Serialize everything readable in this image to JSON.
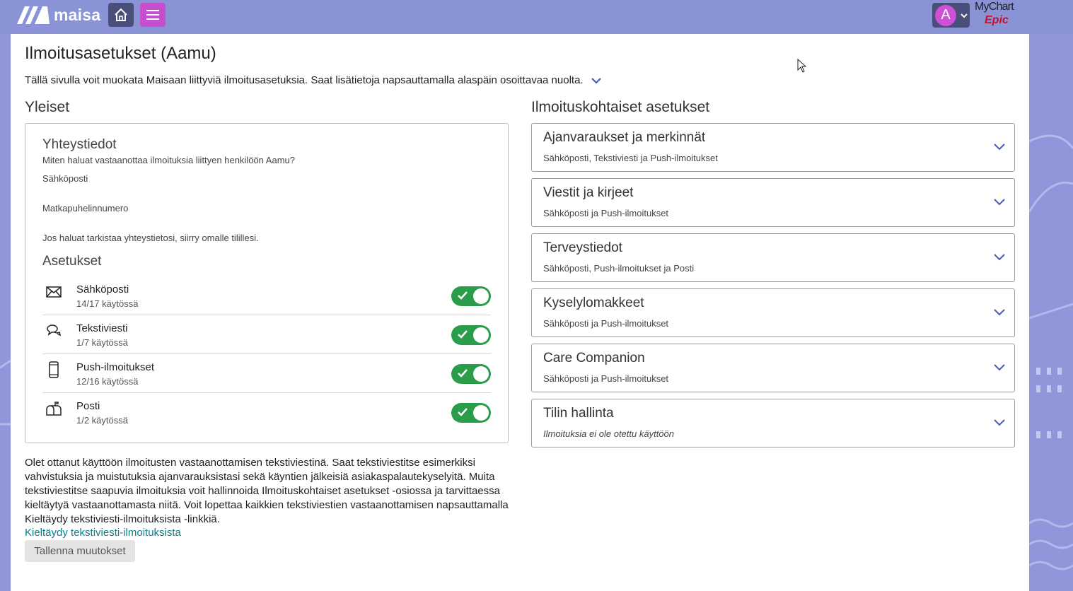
{
  "header": {
    "brand": "maisa",
    "account_initial": "A",
    "partner_name": "MyChart",
    "partner_sub": "Epic",
    "colors": {
      "bar": "#8a93d6",
      "home": "#4a4e7a",
      "menu": "#c64fd0",
      "avatar": "#cf4fd6"
    },
    "icons": {
      "home": "home-icon",
      "menu": "hamburger-menu-icon",
      "account": "chevron-down-icon"
    }
  },
  "page": {
    "title": "Ilmoitusasetukset (Aamu)",
    "intro": "Tällä sivulla voit muokata Maisaan liittyviä ilmoitusasetuksia. Saat lisätietoja napsauttamalla alaspäin osoittavaa nuolta."
  },
  "general": {
    "heading": "Yleiset",
    "contact_title": "Yhteystiedot",
    "contact_question": "Miten haluat vastaanottaa ilmoituksia liittyen henkilöön Aamu?",
    "email_label": "Sähköposti",
    "phone_label": "Matkapuhelinnumero",
    "account_hint": "Jos haluat tarkistaa yhteystietosi, siirry omalle tilillesi.",
    "settings_title": "Asetukset",
    "channels": [
      {
        "label": "Sähköposti",
        "count": "14/17 käytössä",
        "icon": "envelope-icon",
        "enabled": true
      },
      {
        "label": "Tekstiviesti",
        "count": "1/7 käytössä",
        "icon": "chat-bubbles-icon",
        "enabled": true
      },
      {
        "label": "Push-ilmoitukset",
        "count": "12/16 käytössä",
        "icon": "mobile-phone-icon",
        "enabled": true
      },
      {
        "label": "Posti",
        "count": "1/2 käytössä",
        "icon": "mailbox-icon",
        "enabled": true
      }
    ],
    "toggle_color": "#2a9d4a"
  },
  "notice": "Olet ottanut käyttöön ilmoitusten vastaanottamisen tekstiviestinä. Saat tekstiviestitse esimerkiksi vahvistuksia ja muistutuksia ajanvarauksistasi sekä käyntien jälkeisiä asiakaspalautekyselyitä. Muita tekstiviestitse saapuvia ilmoituksia voit hallinnoida Ilmoituskohtaiset asetukset -osiossa ja tarvittaessa kieltäytyä vastaanottamasta niitä. Voit lopettaa kaikkien tekstiviestien vastaanottamisen napsauttamalla Kieltäydy tekstiviesti-ilmoituksista -linkkiä.",
  "optout_link": "Kieltäydy tekstiviesti-ilmoituksista",
  "save_button": "Tallenna muutokset",
  "specific": {
    "heading": "Ilmoituskohtaiset asetukset",
    "items": [
      {
        "title": "Ajanvaraukset ja merkinnät",
        "sub": "Sähköposti, Tekstiviesti ja Push-ilmoitukset"
      },
      {
        "title": "Viestit ja kirjeet",
        "sub": "Sähköposti ja Push-ilmoitukset"
      },
      {
        "title": "Terveystiedot",
        "sub": "Sähköposti, Push-ilmoitukset ja Posti"
      },
      {
        "title": "Kyselylomakkeet",
        "sub": "Sähköposti ja Push-ilmoitukset"
      },
      {
        "title": "Care Companion",
        "sub": "Sähköposti ja Push-ilmoitukset"
      },
      {
        "title": "Tilin hallinta",
        "sub": "Ilmoituksia ei ole otettu käyttöön"
      }
    ]
  }
}
